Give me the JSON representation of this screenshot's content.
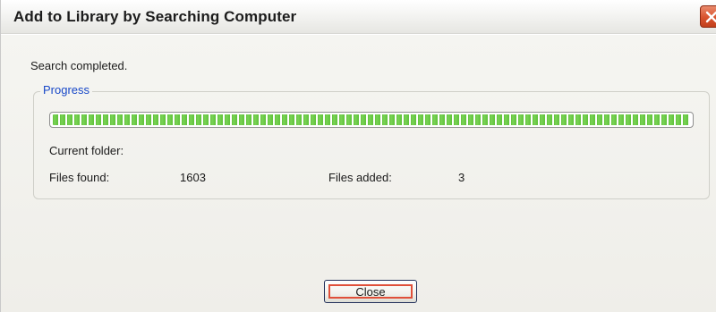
{
  "window": {
    "title": "Add to Library by Searching Computer",
    "close_icon": "close-icon",
    "close_color": "#d8532e"
  },
  "status": {
    "message": "Search completed."
  },
  "progress_group": {
    "legend": "Progress",
    "legend_color": "#1848c8",
    "progress_fraction": 1.0,
    "progress_color": "#5fc23a",
    "current_folder_label": "Current folder:",
    "current_folder_value": "",
    "files_found_label": "Files found:",
    "files_found_value": "1603",
    "files_added_label": "Files added:",
    "files_added_value": "3"
  },
  "buttons": {
    "close_label": "Close"
  }
}
